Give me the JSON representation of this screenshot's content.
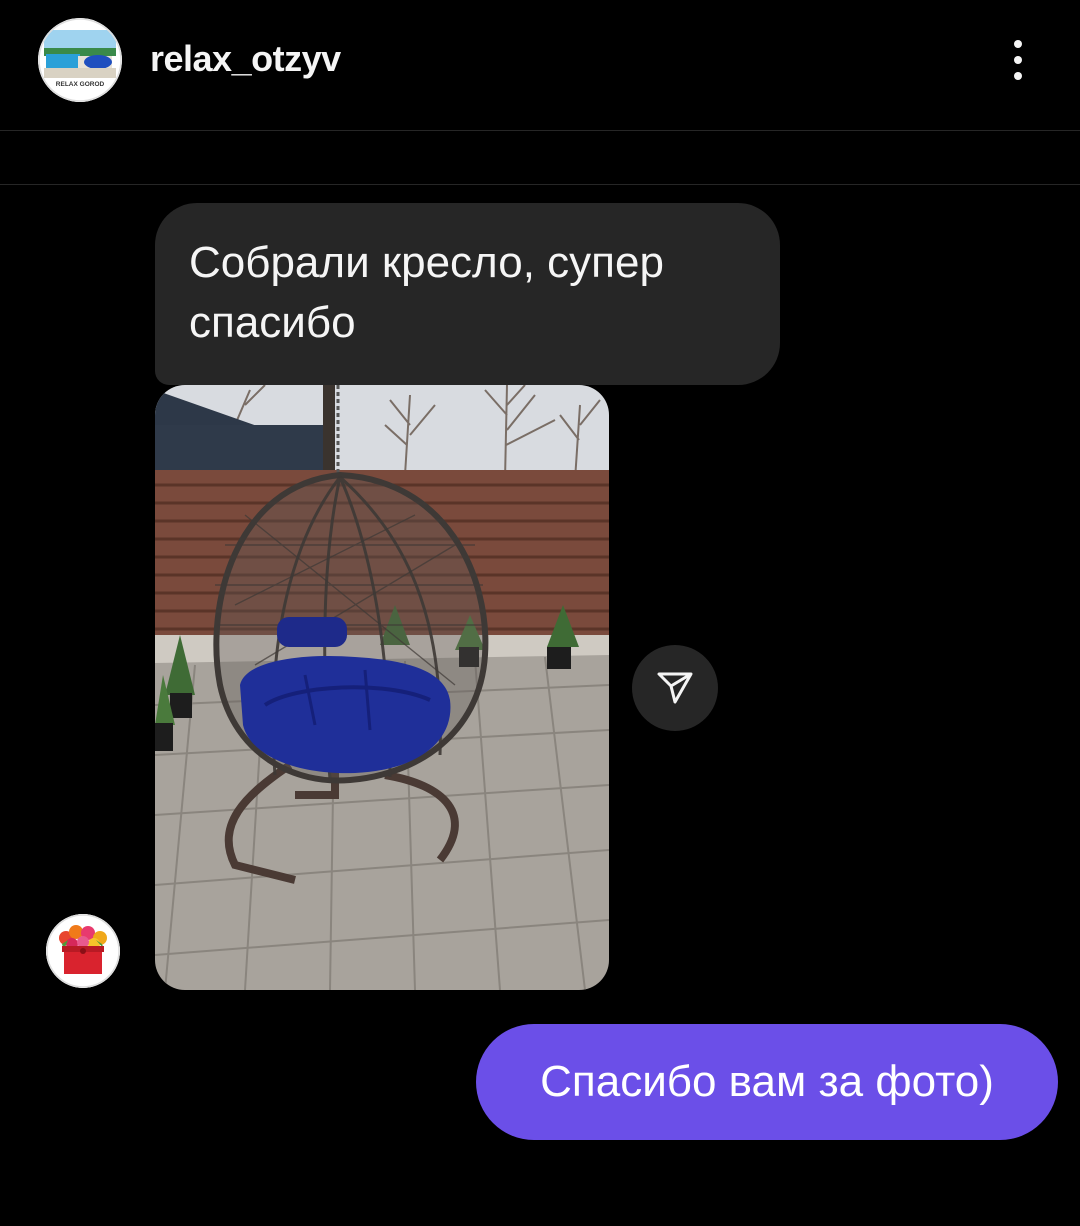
{
  "header": {
    "username": "relax_otzyv",
    "avatar_icon": "relax-gorod-logo-avatar",
    "avatar_logo_text": "RELAX GOROD",
    "more_icon": "more-vertical-icon"
  },
  "messages": {
    "incoming_text": "Собрали кресло, супер спасибо",
    "incoming_photo_icon": "hanging-egg-chair-photo",
    "share_icon": "send-paper-plane-icon",
    "sender_avatar_icon": "flower-box-avatar",
    "outgoing_text": "Спасибо вам за фото)"
  },
  "colors": {
    "background": "#000000",
    "incoming_bubble": "#262626",
    "outgoing_bubble": "#6b4fe8",
    "divider": "#262626"
  }
}
